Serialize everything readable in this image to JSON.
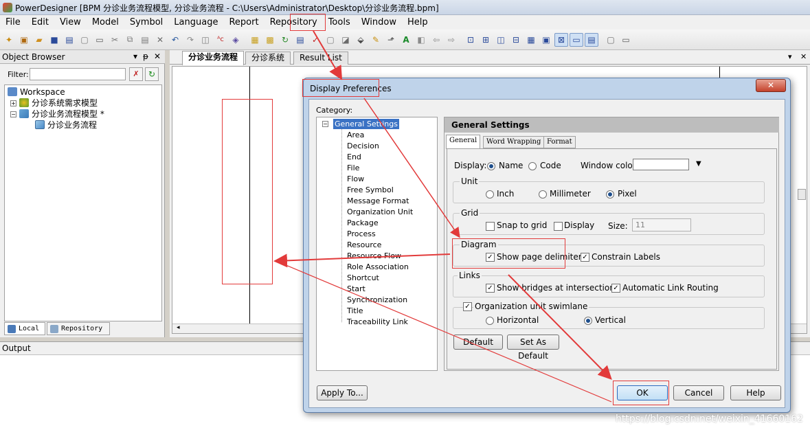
{
  "window": {
    "title": "PowerDesigner [BPM 分诊业务流程模型, 分诊业务流程 - C:\\Users\\Administrator\\Desktop\\分诊业务流程.bpm]"
  },
  "menu": [
    "File",
    "Edit",
    "View",
    "Model",
    "Symbol",
    "Language",
    "Report",
    "Repository",
    "Tools",
    "Window",
    "Help"
  ],
  "object_browser": {
    "title": "Object Browser",
    "filter_label": "Filter:",
    "tree": {
      "workspace": "Workspace",
      "model1": "分诊系统需求模型",
      "model2": "分诊业务流程模型 *",
      "diagram": "分诊业务流程"
    },
    "tabs": [
      "Local",
      "Repository"
    ]
  },
  "doc_tabs": [
    "分诊业务流程",
    "分诊系统",
    "Result List"
  ],
  "output": {
    "title": "Output"
  },
  "dialog": {
    "title": "Display Preferences",
    "close": "✕",
    "category_label": "Category:",
    "categories": [
      "General Settings",
      "Area",
      "Decision",
      "End",
      "File",
      "Flow",
      "Free Symbol",
      "Message Format",
      "Organization Unit",
      "Package",
      "Process",
      "Resource",
      "Resource Flow",
      "Role Association",
      "Shortcut",
      "Start",
      "Synchronization",
      "Title",
      "Traceability Link"
    ],
    "panel_title": "General Settings",
    "tabs": [
      "General",
      "Word Wrapping",
      "Format"
    ],
    "display_label": "Display:",
    "display_name": "Name",
    "display_code": "Code",
    "window_color": "Window color:",
    "unit": {
      "title": "Unit",
      "inch": "Inch",
      "millimeter": "Millimeter",
      "pixel": "Pixel",
      "selected": "Pixel"
    },
    "grid": {
      "title": "Grid",
      "snap": "Snap to grid",
      "display": "Display",
      "size_label": "Size:",
      "size_value": "11"
    },
    "diagram": {
      "title": "Diagram",
      "show_page_delimiter": "Show page delimiter",
      "constrain_labels": "Constrain Labels"
    },
    "links": {
      "title": "Links",
      "show_bridges": "Show bridges at intersections",
      "auto_routing": "Automatic Link Routing"
    },
    "swimlane": {
      "title": "Organization unit swimlane",
      "horizontal": "Horizontal",
      "vertical": "Vertical",
      "selected": "Vertical"
    },
    "buttons": {
      "default": "Default",
      "set_as_default": "Set As Default",
      "apply_to": "Apply To...",
      "ok": "OK",
      "cancel": "Cancel",
      "help": "Help"
    }
  },
  "watermark": "https://blog.csdn.net/weixin_41660162",
  "annotation_color": "#e23a3a"
}
